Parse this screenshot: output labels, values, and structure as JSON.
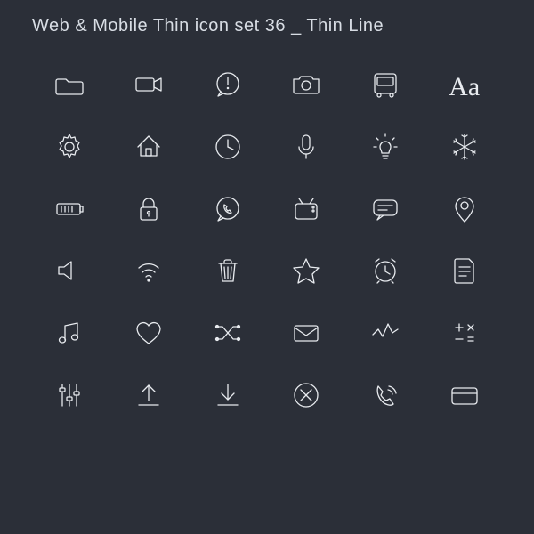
{
  "title": "Web & Mobile Thin icon set 36 _ Thin Line",
  "typography_sample": "Aa",
  "icons": [
    [
      "folder",
      "video-camera",
      "alert-bubble",
      "camera",
      "bus",
      "typography"
    ],
    [
      "gear",
      "home",
      "clock",
      "microphone",
      "lightbulb",
      "snowflake"
    ],
    [
      "battery",
      "lock",
      "phone-bubble",
      "tv",
      "chat-bubble",
      "location-pin"
    ],
    [
      "speaker",
      "wifi",
      "trash",
      "star",
      "alarm-clock",
      "document"
    ],
    [
      "music-note",
      "heart",
      "shuffle",
      "mail-envelope",
      "activity",
      "math-operators"
    ],
    [
      "equalizer-sliders",
      "upload",
      "download",
      "cancel-circle",
      "phone-call",
      "credit-card"
    ]
  ]
}
